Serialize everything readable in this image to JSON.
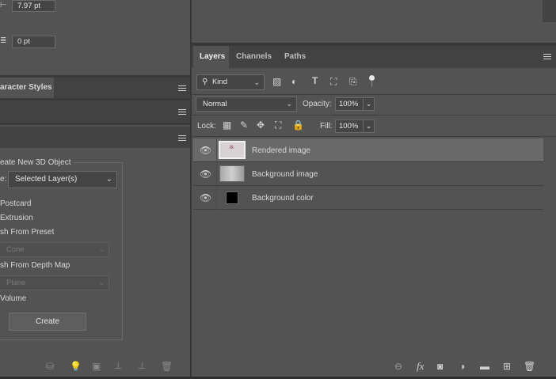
{
  "left_panel": {
    "field_top_value": "7.97 pt",
    "field_second_value": "0 pt",
    "char_styles_tab": "aracter Styles",
    "threed": {
      "create_new_label": "eate New 3D Object",
      "source_label": "e:",
      "source_value": "Selected Layer(s)",
      "option_postcard": "Postcard",
      "option_extrusion": "Extrusion",
      "option_mesh_preset": "sh From Preset",
      "preset_value": "Cone",
      "option_mesh_depth": "sh From Depth Map",
      "depth_value": "Plane",
      "option_volume": "Volume",
      "create_button": "Create"
    }
  },
  "layers_panel": {
    "tabs": [
      "Layers",
      "Channels",
      "Paths"
    ],
    "filter_kind": "Kind",
    "blend_mode": "Normal",
    "opacity_label": "Opacity:",
    "opacity_value": "100%",
    "lock_label": "Lock:",
    "fill_label": "Fill:",
    "fill_value": "100%",
    "layers": [
      {
        "name": "Rendered image",
        "visible": true,
        "selected": true
      },
      {
        "name": "Background image",
        "visible": true,
        "selected": false
      },
      {
        "name": "Background color",
        "visible": true,
        "selected": false
      }
    ]
  },
  "icons": {
    "eye": "eye-icon",
    "search": "search-icon",
    "link": "link-icon",
    "fx": "fx-icon",
    "mask": "mask-icon",
    "adjustment": "adjustment-icon",
    "folder": "folder-icon",
    "new_layer": "new-layer-icon",
    "trash": "trash-icon"
  },
  "colors": {
    "panel_bg": "#535353",
    "selected_row": "#696969",
    "divider": "#383838"
  }
}
